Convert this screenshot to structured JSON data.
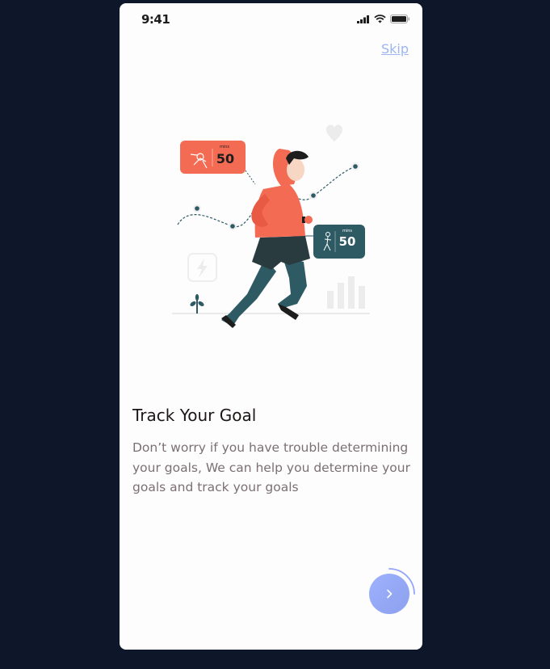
{
  "status": {
    "time": "9:41",
    "icons": [
      "signal-icon",
      "wifi-icon",
      "battery-icon"
    ]
  },
  "header": {
    "skip_label": "Skip"
  },
  "onboarding": {
    "title": "Track Your Goal",
    "description": "Don’t worry if you have trouble determining your goals, We can help you determine your goals and track your goals",
    "progress": 0.25,
    "illustration": {
      "card_1": {
        "label": "mins",
        "value": "50"
      },
      "card_2": {
        "label": "mins",
        "value": "50"
      }
    }
  },
  "colors": {
    "page_background": "#0e172a",
    "screen_background": "#fdfdfd",
    "accent": "#92a3fd",
    "title": "#1d1617",
    "body_text": "#7b6f72",
    "runner_orange": "#f46b54",
    "runner_teal": "#2e5a64"
  },
  "next_button_icon": "chevron-right-icon"
}
